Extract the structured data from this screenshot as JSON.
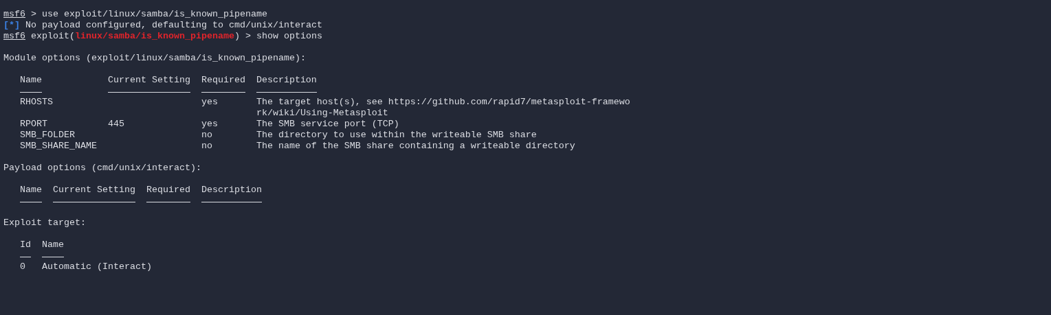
{
  "lines": [
    [
      {
        "text": "msf6",
        "kind": "prompt"
      },
      {
        "text": " > use exploit/linux/samba/is_known_pipename",
        "kind": "plain"
      }
    ],
    [
      {
        "text": "[*]",
        "kind": "info"
      },
      {
        "text": " No payload configured, defaulting to cmd/unix/interact",
        "kind": "plain"
      }
    ],
    [
      {
        "text": "msf6",
        "kind": "prompt"
      },
      {
        "text": " exploit(",
        "kind": "plain"
      },
      {
        "text": "linux/samba/is_known_pipename",
        "kind": "module"
      },
      {
        "text": ") > show options",
        "kind": "plain"
      }
    ]
  ],
  "sections": [
    {
      "heading": "Module options (exploit/linux/samba/is_known_pipename):",
      "columns": [
        "Name",
        "Current Setting",
        "Required",
        "Description"
      ],
      "rows": [
        [
          "RHOSTS",
          "",
          "yes",
          "The target host(s), see https://github.com/rapid7/metasploit-framework/wiki/Using-Metasploit"
        ],
        [
          "RPORT",
          "445",
          "yes",
          "The SMB service port (TCP)"
        ],
        [
          "SMB_FOLDER",
          "",
          "no",
          "The directory to use within the writeable SMB share"
        ],
        [
          "SMB_SHARE_NAME",
          "",
          "no",
          "The name of the SMB share containing a writeable directory"
        ]
      ]
    },
    {
      "heading": "Payload options (cmd/unix/interact):",
      "columns": [
        "Name",
        "Current Setting",
        "Required",
        "Description"
      ]
    },
    {
      "heading": "Exploit target:",
      "columns": [
        "Id",
        "Name"
      ],
      "rows": [
        [
          "0",
          "Automatic (Interact)"
        ]
      ]
    }
  ]
}
